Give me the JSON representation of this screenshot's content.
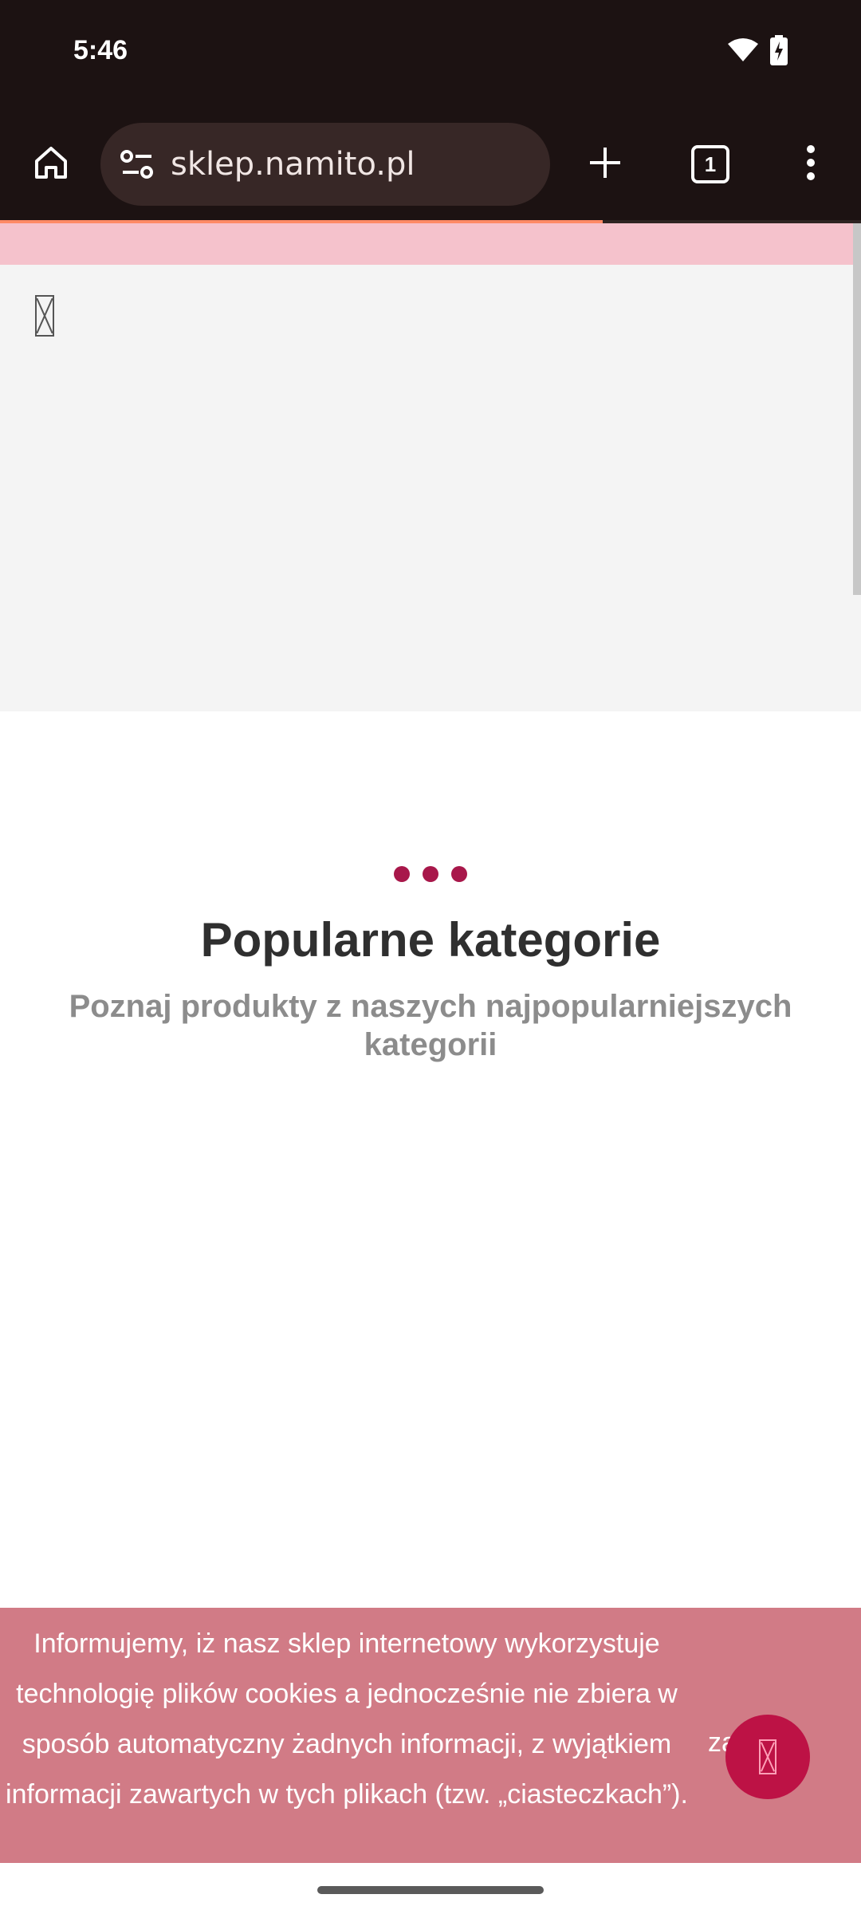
{
  "status_bar": {
    "time": "5:46",
    "icons": [
      "wifi-icon",
      "battery-charging-icon"
    ]
  },
  "browser": {
    "url": "sklep.namito.pl",
    "tab_count": "1",
    "load_progress": 0.7,
    "icons": [
      "home-icon",
      "site-settings-icon",
      "new-tab-icon",
      "tab-switcher-icon",
      "more-menu-icon"
    ],
    "accent_color": "#ff8a66"
  },
  "section": {
    "title": "Popularne kategorie",
    "subtitle": "Poznaj produkty z naszych najpopularniejszych kategorii"
  },
  "cookie_banner": {
    "message": "Informujemy, iż nasz sklep internetowy wykorzystuje technologię plików cookies a jednocześnie nie zbiera w sposób automatyczny żadnych informacji, z wyjątkiem informacji zawartych w tych plikach (tzw. „ciasteczkach”).",
    "close_label": "zamknij",
    "background_color": "#d17b86"
  },
  "colors": {
    "brand": "#a8174a",
    "promo_strip": "#f5c2cc"
  }
}
